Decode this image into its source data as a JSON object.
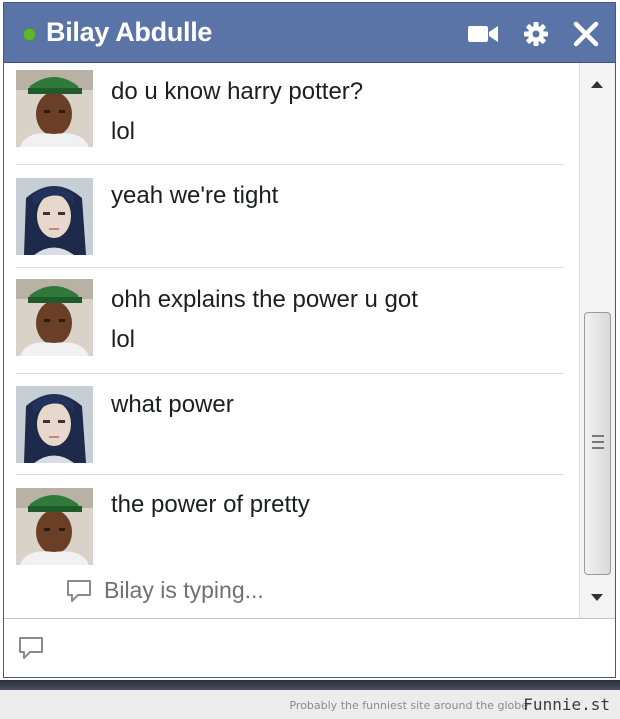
{
  "chat": {
    "contact_name": "Bilay Abdulle",
    "status": "online",
    "icons": {
      "status": "online-status-dot",
      "video": "video-call-icon",
      "settings": "gear-icon",
      "close": "close-icon"
    },
    "messages": [
      {
        "sender": "boy",
        "lines": [
          "do u know harry potter?",
          "lol"
        ]
      },
      {
        "sender": "girl",
        "lines": [
          "yeah we're tight"
        ]
      },
      {
        "sender": "boy",
        "lines": [
          "ohh explains the power u got",
          "lol"
        ]
      },
      {
        "sender": "girl",
        "lines": [
          "what power"
        ]
      },
      {
        "sender": "boy",
        "lines": [
          "the power of pretty"
        ]
      }
    ],
    "typing_indicator": "Bilay is typing...",
    "input": {
      "value": "",
      "placeholder": ""
    }
  },
  "footer": {
    "tagline": "Probably the funniest site around the globe",
    "logo": "Funnie.st"
  },
  "colors": {
    "titlebar": "#5b74a8",
    "online": "#5eb82b",
    "text": "#1c1e21"
  }
}
